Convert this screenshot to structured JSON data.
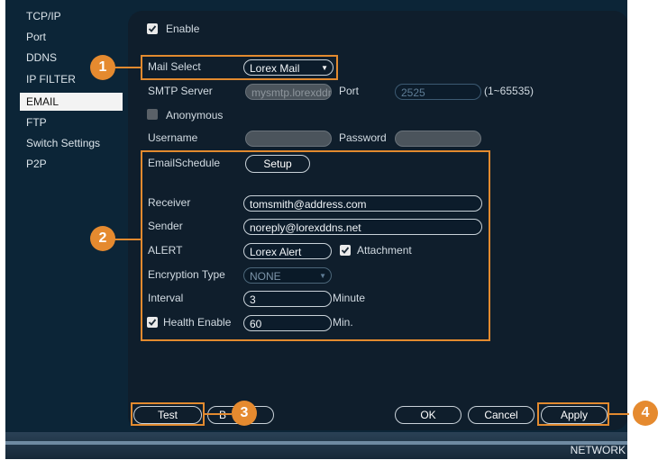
{
  "sidebar": {
    "items": [
      {
        "label": "TCP/IP",
        "active": false
      },
      {
        "label": "Port",
        "active": false
      },
      {
        "label": "DDNS",
        "active": false
      },
      {
        "label": "IP FILTER",
        "active": false
      },
      {
        "label": "EMAIL",
        "active": true
      },
      {
        "label": "FTP",
        "active": false
      },
      {
        "label": "Switch Settings",
        "active": false
      },
      {
        "label": "P2P",
        "active": false
      }
    ]
  },
  "form": {
    "enable_label": "Enable",
    "mail_select_label": "Mail Select",
    "mail_select_value": "Lorex Mail",
    "smtp_server_label": "SMTP Server",
    "smtp_server_value": "mysmtp.lorexddns.net",
    "port_label": "Port",
    "port_value": "2525",
    "port_range": "(1~65535)",
    "anonymous_label": "Anonymous",
    "username_label": "Username",
    "password_label": "Password",
    "email_schedule_label": "EmailSchedule",
    "setup_label": "Setup",
    "receiver_label": "Receiver",
    "receiver_value": "tomsmith@address.com",
    "sender_label": "Sender",
    "sender_value": "noreply@lorexddns.net",
    "alert_label": "ALERT",
    "alert_value": "Lorex Alert",
    "attachment_label": "Attachment",
    "encryption_label": "Encryption Type",
    "encryption_value": "NONE",
    "interval_label": "Interval",
    "interval_value": "3",
    "interval_unit": "Minute",
    "health_enable_label": "Health Enable",
    "health_value": "60",
    "health_unit": "Min."
  },
  "buttons": {
    "test": "Test",
    "back": "B",
    "ok": "OK",
    "cancel": "Cancel",
    "apply": "Apply"
  },
  "callouts": [
    "1",
    "2",
    "3",
    "4"
  ],
  "footer": {
    "section": "NETWORK"
  },
  "colors": {
    "accent": "#e28a2f",
    "background": "#0c2537",
    "panel": "#0f1e2c"
  }
}
